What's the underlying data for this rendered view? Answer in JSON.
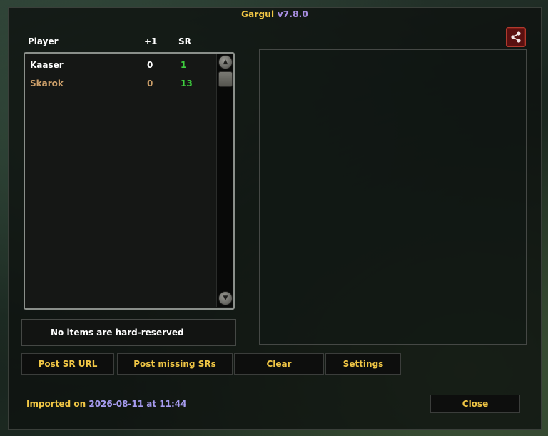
{
  "window": {
    "title_name": "Gargul",
    "title_version": "v7.8.0"
  },
  "table": {
    "headers": {
      "player": "Player",
      "plus_one": "+1",
      "sr": "SR"
    },
    "rows": [
      {
        "player": "Kaaser",
        "plus_one": "0",
        "sr": "1"
      },
      {
        "player": "Skarok",
        "plus_one": "0",
        "sr": "13"
      }
    ]
  },
  "hard_reserve": {
    "message": "No items are hard-reserved"
  },
  "buttons": {
    "post_sr_url": "Post SR URL",
    "post_missing": "Post missing SRs",
    "clear": "Clear",
    "settings": "Settings",
    "close": "Close"
  },
  "footer": {
    "imported_label": "Imported on",
    "imported_value": "2026-08-11 at 11:44"
  },
  "colors": {
    "accent_gold": "#f0c645",
    "version_purple": "#a78de0",
    "sr_green": "#3ecf3e",
    "offline_player": "#cda06a",
    "share_red": "#b03a2e"
  },
  "icons": {
    "share": "share-icon",
    "scroll_up": "scroll-up-icon",
    "scroll_down": "scroll-down-icon"
  }
}
